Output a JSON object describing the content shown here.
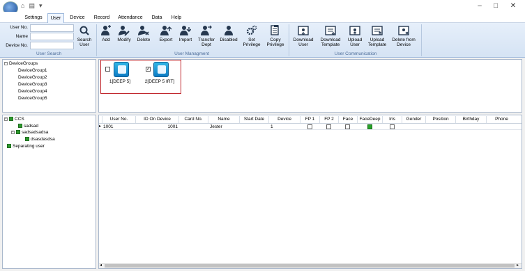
{
  "app": {
    "title": ""
  },
  "quick_access": [
    "home-icon",
    "save-icon",
    "dropdown-icon"
  ],
  "window_controls": {
    "minimize": "–",
    "maximize": "□",
    "close": "✕"
  },
  "menu": [
    "Settings",
    "User",
    "Device",
    "Record",
    "Attendance",
    "Data",
    "Help"
  ],
  "menu_active": "User",
  "ribbon": {
    "user_search": {
      "fields": [
        {
          "label": "User No.",
          "value": ""
        },
        {
          "label": "Name",
          "value": ""
        },
        {
          "label": "Device No.",
          "value": ""
        }
      ],
      "search_label": "Search User",
      "group_label": "User Search"
    },
    "user_management": {
      "buttons": [
        "Add",
        "Modify",
        "Delete",
        "Export",
        "Import",
        "Transfer Dept",
        "Disabled",
        "Set Privilege",
        "Copy Privilege"
      ],
      "group_label": "User Managment"
    },
    "user_communication": {
      "buttons": [
        "Download User",
        "Download Template",
        "Upload User",
        "Upload Template",
        "Delete from Device"
      ],
      "group_label": "User Communication"
    }
  },
  "device_tree": {
    "root": "DeviceGroups",
    "children": [
      "DeviceGroup1",
      "DeviceGroup2",
      "DeviceGroup3",
      "DeviceGroup4",
      "DeviceGroup5"
    ]
  },
  "devices": [
    {
      "label": "1[DEEP 5]",
      "checked": false
    },
    {
      "label": "2[DEEP 5 IRT]",
      "checked": true
    }
  ],
  "org_tree": {
    "root": "CCS",
    "children": [
      {
        "label": "sadsad"
      },
      {
        "label": "sadsadsadsa",
        "children": [
          {
            "label": "dsasdasdsa"
          }
        ]
      }
    ],
    "separating": "Separating user"
  },
  "grid": {
    "columns": [
      "User No.",
      "ID On Device",
      "Card No.",
      "Name",
      "Start Date",
      "Device",
      "FP 1",
      "FP 2",
      "Face",
      "FaceDeep",
      "Iris",
      "Gender",
      "Position",
      "Birthday",
      "Phone"
    ],
    "rows": [
      {
        "user_no": "1001",
        "id_on_device": "1001",
        "card_no": "",
        "name": "Jester",
        "start_date": "",
        "device": "1",
        "fp1": false,
        "fp2": false,
        "face": false,
        "facedeep": true,
        "iris": false,
        "gender": "",
        "position": "",
        "birthday": "",
        "phone": ""
      }
    ]
  },
  "colors": {
    "accent": "#1d4f9a",
    "selected": "#27a32a",
    "highlight_border": "#c0262c"
  }
}
